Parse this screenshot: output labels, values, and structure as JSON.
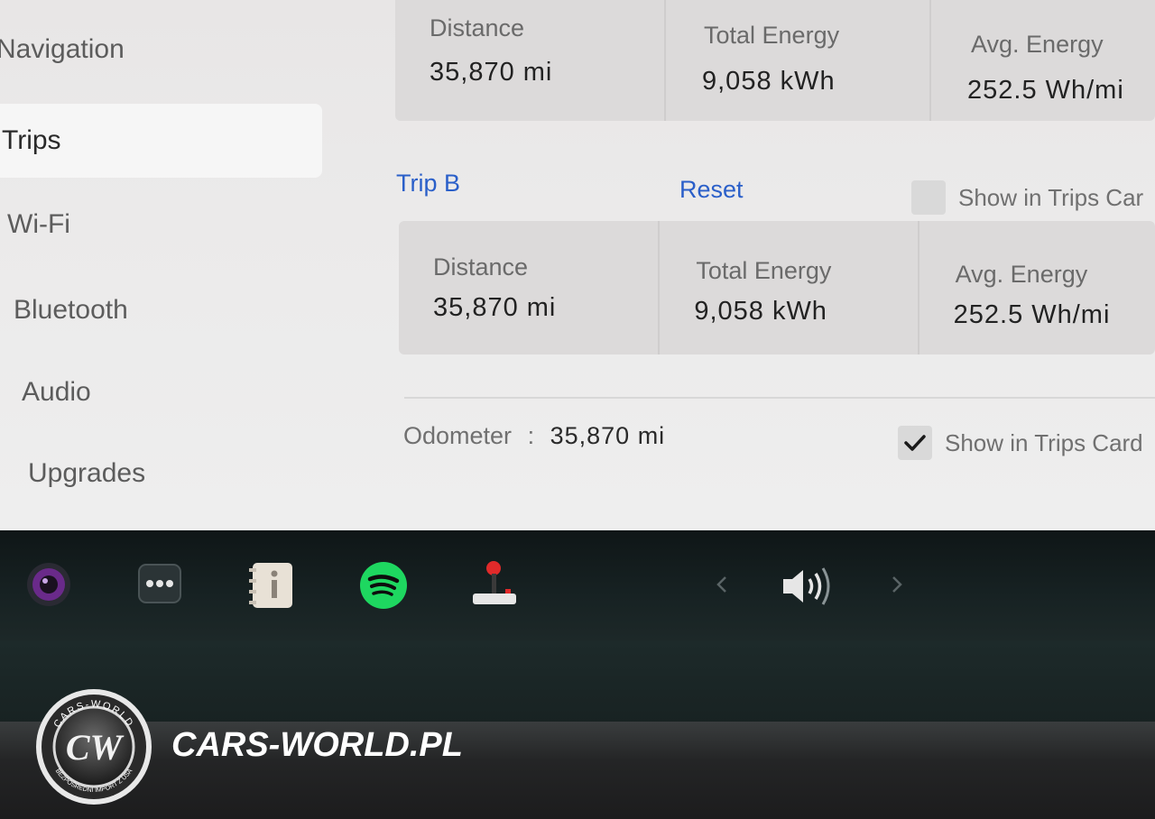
{
  "sidebar": {
    "items": [
      {
        "label": "Navigation"
      },
      {
        "label": "Trips"
      },
      {
        "label": "Wi-Fi"
      },
      {
        "label": "Bluetooth"
      },
      {
        "label": "Audio"
      },
      {
        "label": "Upgrades"
      }
    ],
    "active": "Trips"
  },
  "trip_a": {
    "distance_label": "Distance",
    "distance_value": "35,870 mi",
    "energy_label": "Total Energy",
    "energy_value": "9,058 kWh",
    "avg_label": "Avg. Energy",
    "avg_value": "252.5 Wh/mi"
  },
  "trip_b": {
    "title": "Trip B",
    "reset_label": "Reset",
    "show_label": "Show in Trips Car",
    "show_checked": false,
    "distance_label": "Distance",
    "distance_value": "35,870 mi",
    "energy_label": "Total Energy",
    "energy_value": "9,058 kWh",
    "avg_label": "Avg. Energy",
    "avg_value": "252.5 Wh/mi"
  },
  "odometer": {
    "label": "Odometer",
    "separator": ":",
    "value": "35,870 mi",
    "show_label": "Show in Trips Card",
    "show_checked": true
  },
  "taskbar": {
    "icons": [
      "camera-icon",
      "more-icon",
      "manual-icon",
      "spotify-icon",
      "joystick-icon",
      "chevron-left-icon",
      "volume-icon",
      "chevron-right-icon"
    ],
    "spotify_color": "#1ed760",
    "accent_blue": "#2a5fc9"
  },
  "watermark": {
    "text": "CARS-WORLD.PL",
    "logo_text": "CW",
    "logo_ring_top": "CARS-WORLD",
    "logo_ring_bottom": "BEZPOŚREDNI IMPORT Z USA"
  }
}
